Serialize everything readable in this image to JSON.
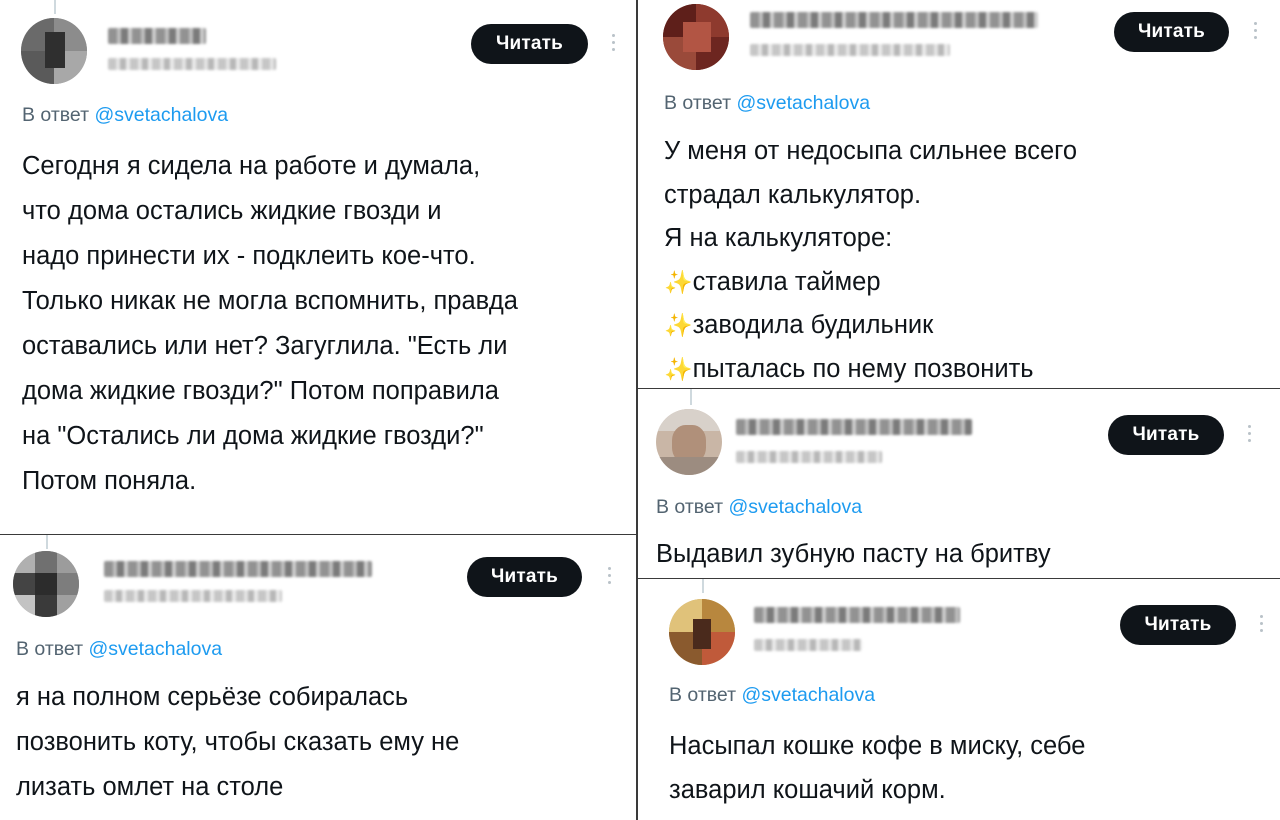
{
  "read_label": "Читать",
  "reply_prefix": "В ответ",
  "reply_mention": "@svetachalova",
  "sparkle_icon": "✨",
  "tweets": [
    {
      "body": [
        "Сегодня я сидела на работе и думала,",
        "что дома остались жидкие гвозди и",
        "надо принести их - подклеить кое-что.",
        "Только никак не могла вспомнить, правда",
        "оставались или нет? Загуглила. \"Есть ли",
        "дома жидкие гвозди?\" Потом поправила",
        "на \"Остались ли дома жидкие гвозди?\"",
        "Потом поняла."
      ]
    },
    {
      "body": [
        "я на полном серьёзе собиралась",
        "позвонить коту, чтобы сказать ему не",
        "лизать омлет на столе"
      ]
    },
    {
      "body": [
        "У меня от недосыпа сильнее всего",
        "страдал калькулятор.",
        "Я на калькуляторе:",
        "ставила таймер",
        "заводила будильник",
        "пыталась по нему позвонить"
      ]
    },
    {
      "body": [
        "Выдавил зубную пасту на бритву"
      ]
    },
    {
      "body": [
        "Насыпал кошке кофе в миску, себе",
        "заварил кошачий корм."
      ]
    }
  ]
}
